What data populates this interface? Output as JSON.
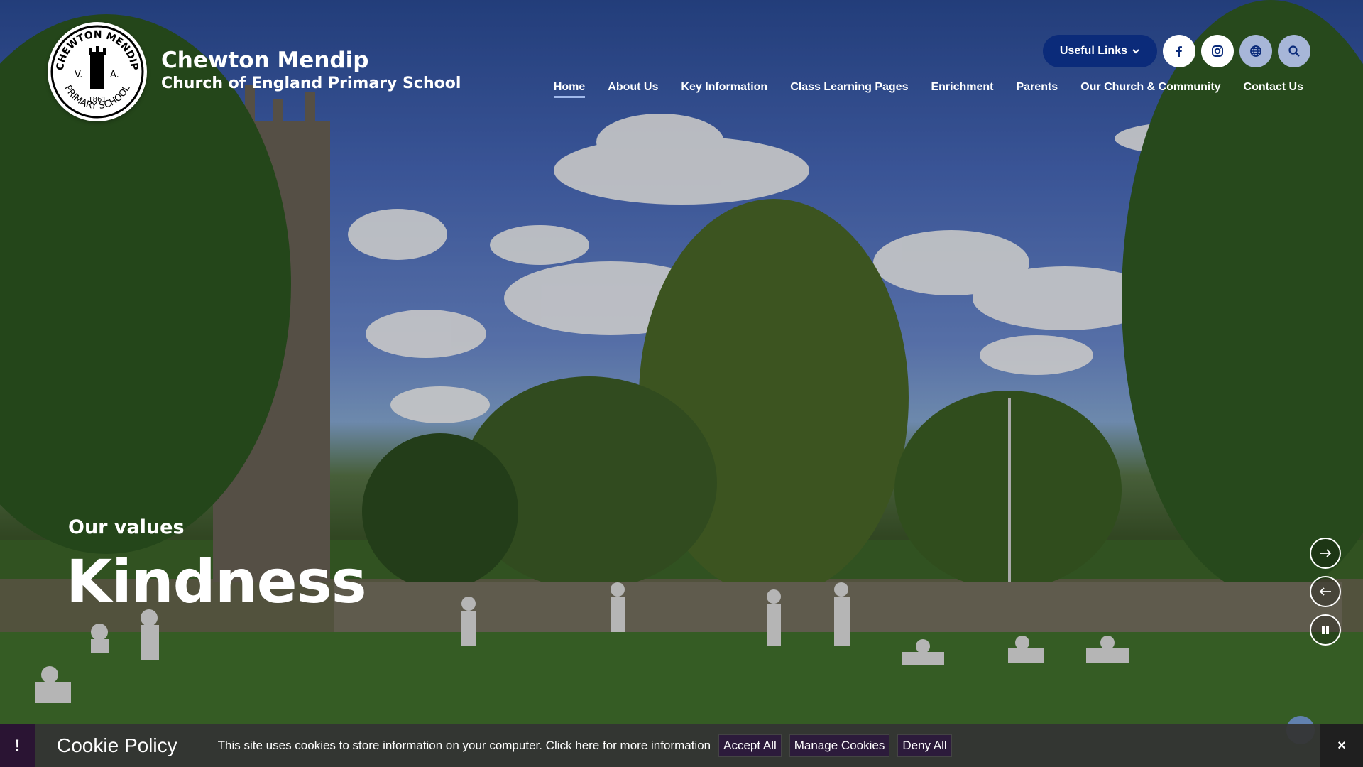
{
  "school": {
    "name_line1": "Chewton Mendip",
    "name_line2": "Church of England Primary School",
    "logo": {
      "text_top": "CHEWTON MENDIP",
      "text_bottom": "PRIMARY SCHOOL",
      "left": "V.",
      "right": "A.",
      "year": "1861"
    }
  },
  "header": {
    "useful_links_label": "Useful Links",
    "icons": [
      "facebook-icon",
      "instagram-icon",
      "globe-icon",
      "search-icon"
    ]
  },
  "nav": {
    "items": [
      {
        "label": "Home",
        "active": true
      },
      {
        "label": "About Us"
      },
      {
        "label": "Key Information"
      },
      {
        "label": "Class Learning Pages"
      },
      {
        "label": "Enrichment"
      },
      {
        "label": "Parents"
      },
      {
        "label": "Our Church & Community"
      },
      {
        "label": "Contact Us"
      }
    ]
  },
  "hero": {
    "caption_small": "Our values",
    "caption_big": "Kindness",
    "controls": [
      "next-arrow-icon",
      "prev-arrow-icon",
      "pause-icon"
    ]
  },
  "cookie": {
    "title": "Cookie Policy",
    "text": "This site uses cookies to store information on your computer. Click here for more information",
    "accept": "Accept All",
    "manage": "Manage Cookies",
    "deny": "Deny All",
    "alert_glyph": "!",
    "close_glyph": "×"
  },
  "colors": {
    "nav_button_bg": "#0b2b7a",
    "active_underline": "#9fb8ea",
    "cookie_bar_bg": "#343434",
    "cookie_button_bg": "#2c1b3b"
  }
}
